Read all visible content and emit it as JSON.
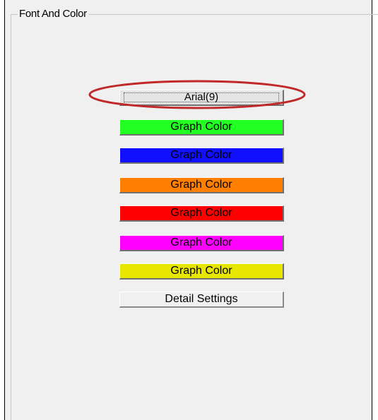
{
  "group": {
    "title": "Font And Color"
  },
  "font_button": {
    "label": "Arial(9)"
  },
  "color_buttons": [
    {
      "label": "Graph Color",
      "color": "#22ff22"
    },
    {
      "label": "Graph Color",
      "color": "#1010ff"
    },
    {
      "label": "Graph Color",
      "color": "#ff8000"
    },
    {
      "label": "Graph Color",
      "color": "#ff0000"
    },
    {
      "label": "Graph Color",
      "color": "#ff00ff"
    },
    {
      "label": "Graph Color",
      "color": "#e6e600"
    }
  ],
  "detail_button": {
    "label": "Detail Settings"
  },
  "annotation": {
    "ellipse_color": "#c0282a"
  }
}
